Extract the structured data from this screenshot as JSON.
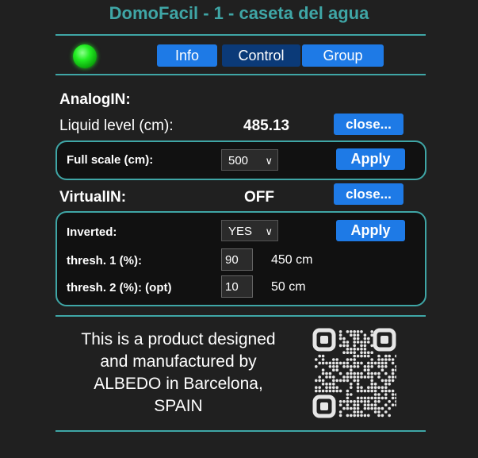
{
  "header": {
    "title": "DomoFacil - 1 - caseta del agua"
  },
  "status": {
    "led_color": "#22ee22",
    "led": "online-indicator"
  },
  "tabs": [
    {
      "label": "Info",
      "active": false
    },
    {
      "label": "Control",
      "active": true
    },
    {
      "label": "Group",
      "active": false
    }
  ],
  "analog": {
    "title": "AnalogIN:",
    "liquid_label": "Liquid level (cm):",
    "liquid_value": "485.13",
    "close_label": "close...",
    "full_scale_label": "Full scale (cm):",
    "full_scale_value": "500",
    "apply_label": "Apply"
  },
  "virtual": {
    "title": "VirtualIN:",
    "state": "OFF",
    "close_label": "close...",
    "inverted_label": "Inverted:",
    "inverted_value": "YES",
    "apply_label": "Apply",
    "thresh1_label": "thresh. 1 (%):",
    "thresh1_value": "90",
    "thresh1_cm": "450 cm",
    "thresh2_label": "thresh. 2 (%): (opt)",
    "thresh2_value": "10",
    "thresh2_cm": "50 cm"
  },
  "footer": {
    "line1": "This is a product designed",
    "line2": "and manufactured by",
    "line3": "ALBEDO in Barcelona,",
    "line4": "SPAIN"
  },
  "colors": {
    "accent": "#3fa6a6",
    "button": "#1e7ae6",
    "active_tab": "#0b3a78",
    "background": "#202020"
  }
}
